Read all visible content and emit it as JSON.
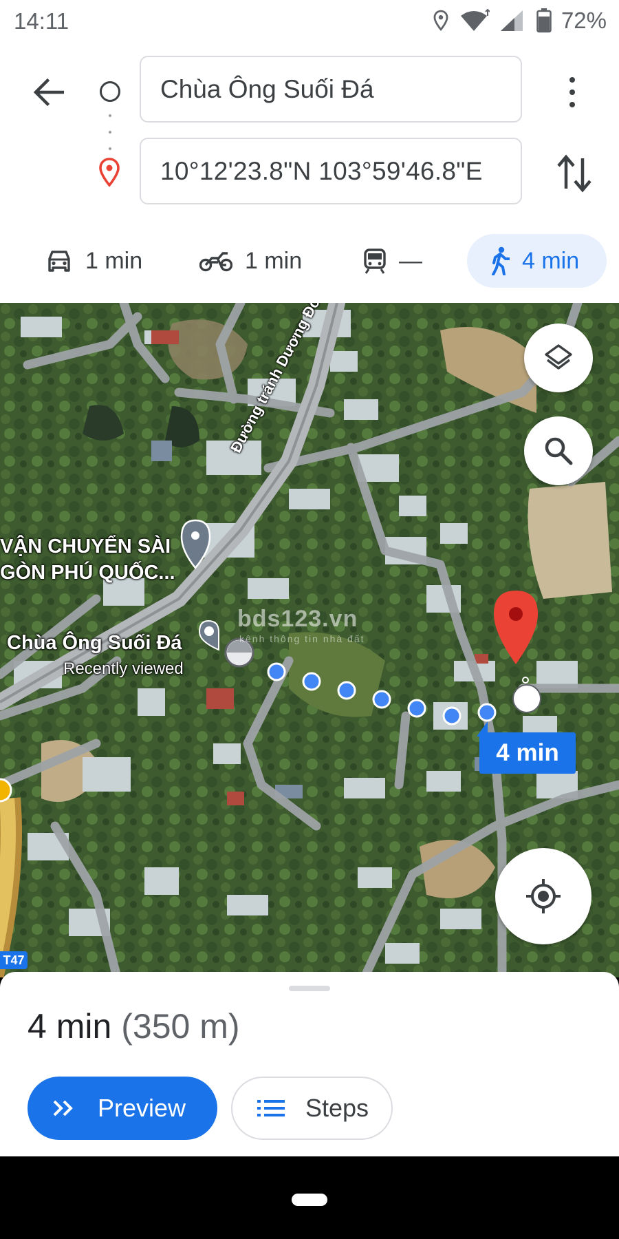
{
  "status_bar": {
    "time": "14:11",
    "battery": "72%",
    "icons": [
      "location-icon",
      "wifi-icon",
      "signal-icon",
      "battery-icon"
    ]
  },
  "directions": {
    "origin": "Chùa Ông Suối Đá",
    "destination": "10°12'23.8\"N 103°59'46.8\"E"
  },
  "travel_modes": [
    {
      "mode": "drive",
      "icon": "car-icon",
      "label": "1 min"
    },
    {
      "mode": "motorcycle",
      "icon": "motorcycle-icon",
      "label": "1 min"
    },
    {
      "mode": "transit",
      "icon": "train-icon",
      "label": "—"
    },
    {
      "mode": "walk",
      "icon": "walk-icon",
      "label": "4 min",
      "selected": true
    }
  ],
  "map": {
    "place_transport_line1": "VẬN CHUYỂN SÀI",
    "place_transport_line2": "GÒN PHÚ QUỐC...",
    "place_pagoda": "Chùa Ông Suối Đá",
    "place_pagoda_sub": "Recently viewed",
    "road_name": "Đường tránh Dương Đông",
    "watermark": "bds123.vn",
    "watermark_sub": "kênh thông tin nhà đất",
    "route_badge": "4 min",
    "highway_tag": "T47"
  },
  "summary": {
    "duration": "4 min",
    "distance": "(350 m)"
  },
  "actions": {
    "preview": "Preview",
    "steps": "Steps"
  },
  "colors": {
    "accent": "#1a73e8",
    "selected_mode_bg": "#e8f0fe",
    "pin_red": "#ea4335"
  }
}
